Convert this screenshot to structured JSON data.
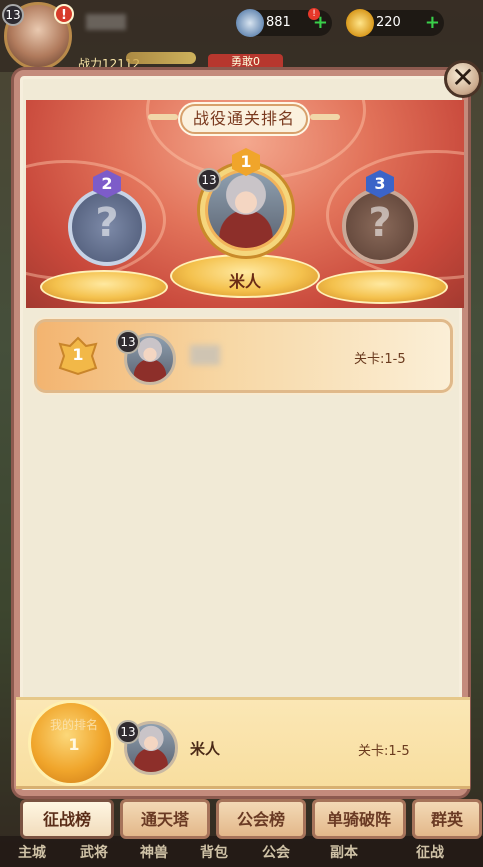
{
  "hud": {
    "level": "13",
    "alert": "!",
    "power": "战力12112",
    "tag": "勇敢0",
    "resource1": "881",
    "resource2": "220",
    "resource_dot": "!"
  },
  "modal": {
    "title": "战役通关排名",
    "close_icon": "close-x"
  },
  "podium": {
    "first": {
      "rank": "1",
      "level": "13",
      "name": "米人"
    },
    "second": {
      "rank": "2",
      "placeholder": "?"
    },
    "third": {
      "rank": "3",
      "placeholder": "?"
    }
  },
  "list": [
    {
      "rank": "1",
      "level": "13",
      "stage": "关卡:1-5"
    }
  ],
  "my_rank": {
    "label": "我的排名",
    "rank": "1",
    "level": "13",
    "name": "米人",
    "stage": "关卡:1-5"
  },
  "tabs": [
    "征战榜",
    "通天塔",
    "公会榜",
    "单骑破阵",
    "群英"
  ],
  "bottom_nav": [
    "主城",
    "武将",
    "神兽",
    "背包",
    "公会",
    "副本",
    "征战"
  ],
  "colors": {
    "accent_gold": "#f4c14d",
    "banner_red": "#e2735a",
    "rank2_purple": "#7d5cc9",
    "rank3_blue": "#3b64c8"
  }
}
